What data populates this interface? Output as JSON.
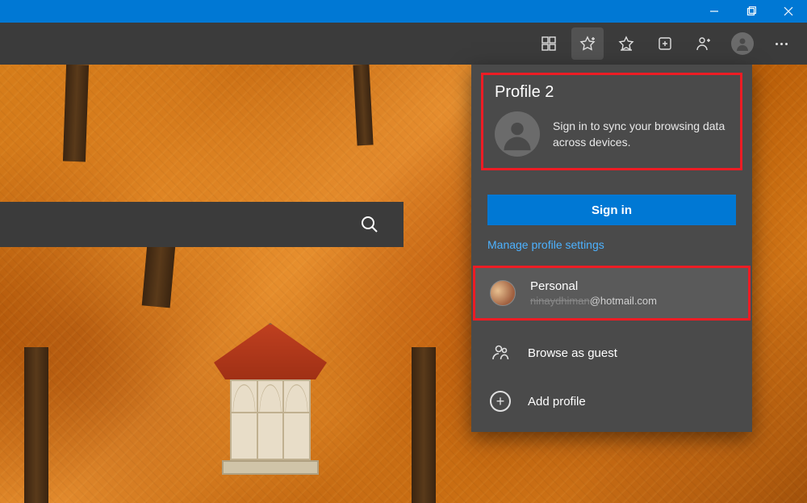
{
  "profileMenu": {
    "title": "Profile 2",
    "description": "Sign in to sync your browsing data across devices.",
    "signInLabel": "Sign in",
    "manageLink": "Manage profile settings",
    "personal": {
      "name": "Personal",
      "emailRedacted": "ninaydhiman",
      "emailDomain": "@hotmail.com"
    },
    "guestLabel": "Browse as guest",
    "addLabel": "Add profile"
  }
}
